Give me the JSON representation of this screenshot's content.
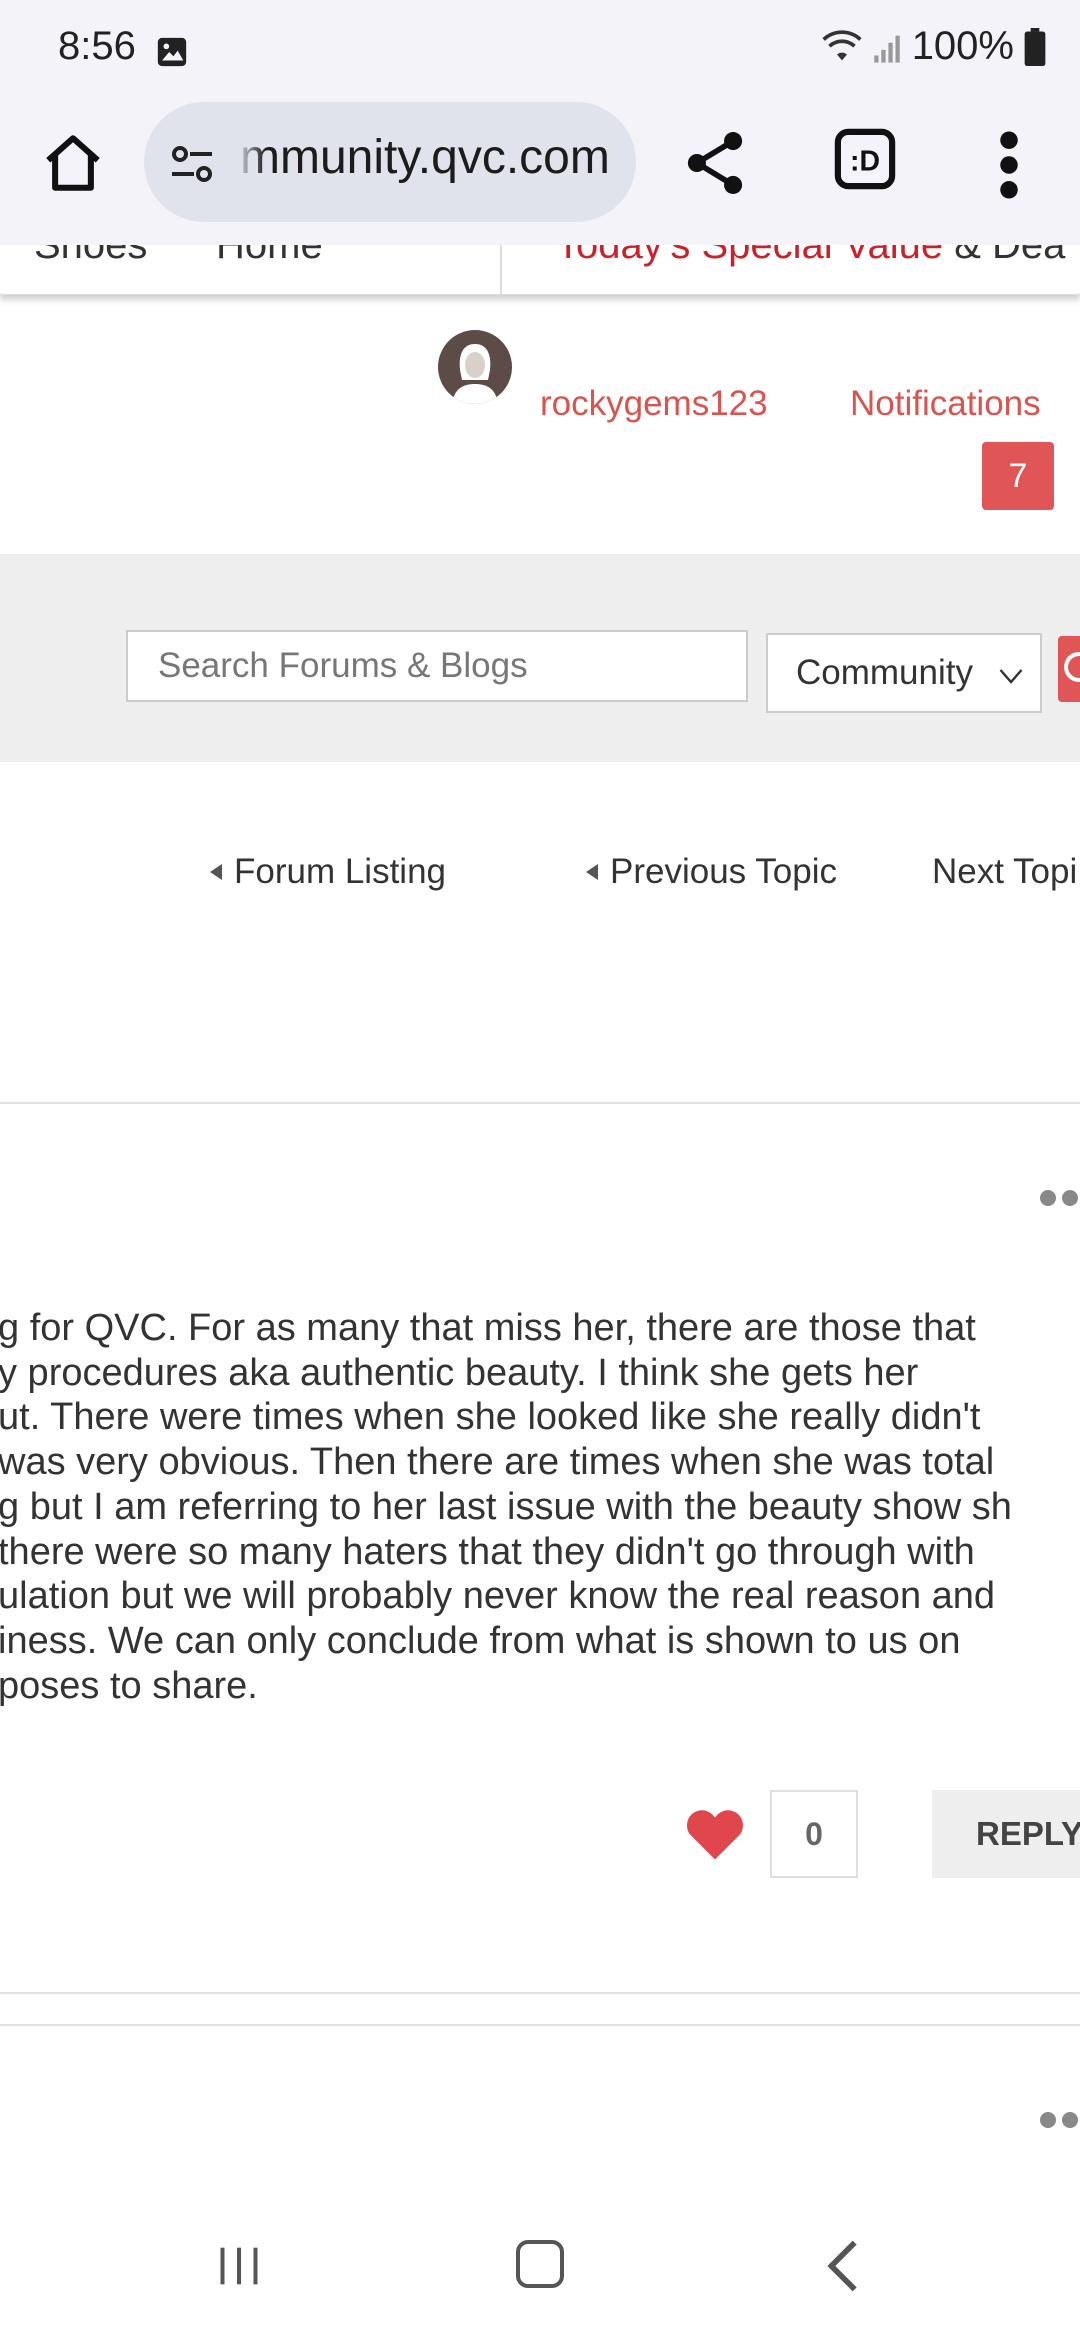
{
  "status_bar": {
    "time": "8:56",
    "battery": "100%",
    "icons": [
      "image-notification-icon",
      "wifi-icon",
      "signal-icon",
      "battery-icon"
    ]
  },
  "browser": {
    "url": "mmunity.qvc.com",
    "icons": [
      "home-icon",
      "site-settings-icon",
      "share-icon",
      "tab-switcher-icon",
      "more-menu-icon"
    ]
  },
  "site_nav": {
    "item_shoes": "Shoes",
    "item_home": "Home",
    "tsv_red": "Today's Special Value",
    "tsv_rest": " & Dea"
  },
  "user": {
    "username": "rockygems123",
    "notifications_label": "Notifications",
    "notifications_count": "7"
  },
  "search": {
    "placeholder": "Search Forums & Blogs",
    "scope_selected": "Community"
  },
  "topic_nav": {
    "forum_listing": "Forum Listing",
    "previous_topic": "Previous Topic",
    "next_topic": "Next Topi"
  },
  "post": {
    "lines": [
      "g for QVC.  For as many that miss her, there are those that",
      "y procedures aka authentic beauty.  I think she gets her",
      "ut. There were times when she looked like she really didn't",
      "was very obvious.  Then there are times when she was total",
      "g but I am referring to her last issue with the beauty show sh",
      " there were so many haters that they didn't go through with",
      "ulation but we will probably never know the real reason and",
      "iness.  We can only conclude from what is shown to us on",
      "poses to share."
    ],
    "like_count": "0",
    "reply_label": "REPLY"
  },
  "colors": {
    "accent": "#d9534f",
    "badge": "#e05656",
    "heart": "#e0474c",
    "tsv_red": "#c8232c"
  }
}
